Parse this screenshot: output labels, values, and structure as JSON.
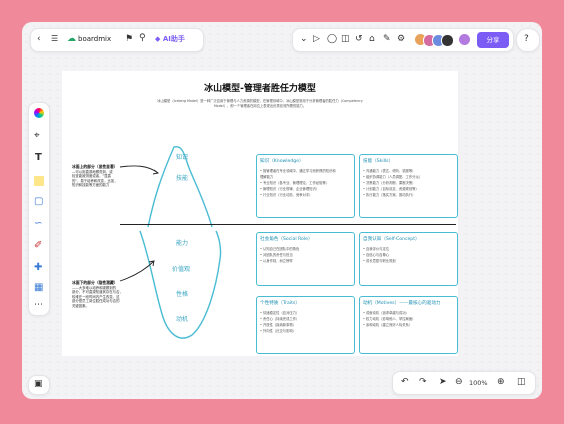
{
  "toolbar": {
    "back_icon": "chevron-left-icon",
    "menu_icon": "hamburger-icon",
    "app_name": "boardmix",
    "ai_label": "AI助手",
    "share_label": "分享",
    "help_label": "?"
  },
  "doc": {
    "title": "冰山模型-管理者胜任力模型",
    "intro_line1": "冰山模型（Iceberg Model）是一种广泛应用于管理与人力资源的模型，在管理领域中，冰山模型常用于分析管理者的胜任力（Competency",
    "intro_line2": "Model），即一个管理者在岗位上表现出优秀绩效所需的能力。",
    "note_top_title": "冰面上的部分（显性显著）",
    "note_top_lines": [
      "—可以用直观地察觉到，或",
      "检查能被测度或者，\"显露",
      "的\"，易于培养和改变，比如，",
      "知识和技能等方面的能力"
    ],
    "note_bottom_title": "冰面下的部分（隐性潜藏）",
    "note_bottom_lines": [
      "——大多难以培养和观察到的",
      "部分，不可直观知道其存在与否，",
      "较难在一段时间内产生改变。这",
      "部分是员工岗位胜任成功与否的",
      "关键因素。"
    ],
    "ice_labels": [
      "知识",
      "技能"
    ],
    "under_labels": [
      "能力",
      "价值观",
      "性格",
      "动机"
    ],
    "boxes": [
      {
        "title": "知识（Knowledge）",
        "lines": [
          "• 指管理者在专业领域中，通过学习而获得的知识和",
          "  理解能力",
          "• 专业知识（各专业、管理理论、工作经验等）",
          "• 管理知识（行业规律、企业管理知识）",
          "• 行业知识（行业动态、竞争对手）"
        ]
      },
      {
        "title": "技能（Skills）",
        "lines": [
          "• 沟通能力（表达、倾听、说服等）",
          "• 组织协调能力（人员调配、工作分派）",
          "• 决策能力（分析判断、果断决策）",
          "• 计划能力（目标设定、资源规划等）",
          "• 执行能力（落实方案、推动执行）"
        ]
      },
      {
        "title": "社会角色（Social Role）",
        "lines": [
          "• 认知自己在团队中的角色",
          "• 对团队的责任与担当",
          "• 以身作则，树立榜样"
        ]
      },
      {
        "title": "自我认知（Self-Concept）",
        "lines": [
          "• 自我评价与定位",
          "• 自信心与自尊心",
          "• 成长意愿与职业规划"
        ]
      },
      {
        "title": "个性特质（Traits）",
        "lines": [
          "• 情绪稳定性（应对压力）",
          "• 责任心（持续完成工作）",
          "• 开放性（接纳新事物）",
          "• 外向性（社交与影响）"
        ]
      },
      {
        "title": "动机（Motives）——最核心的驱动力",
        "lines": [
          "• 成就动机（追求卓越与成功）",
          "• 权力动机（影响他人、掌控局面）",
          "• 亲和动机（建立良好人际关系）"
        ]
      }
    ]
  },
  "zoom": {
    "level": "100%"
  },
  "colors": {
    "accent": "#7b5cf5",
    "ice": "#49bcd3",
    "border": "#49bcd3"
  }
}
